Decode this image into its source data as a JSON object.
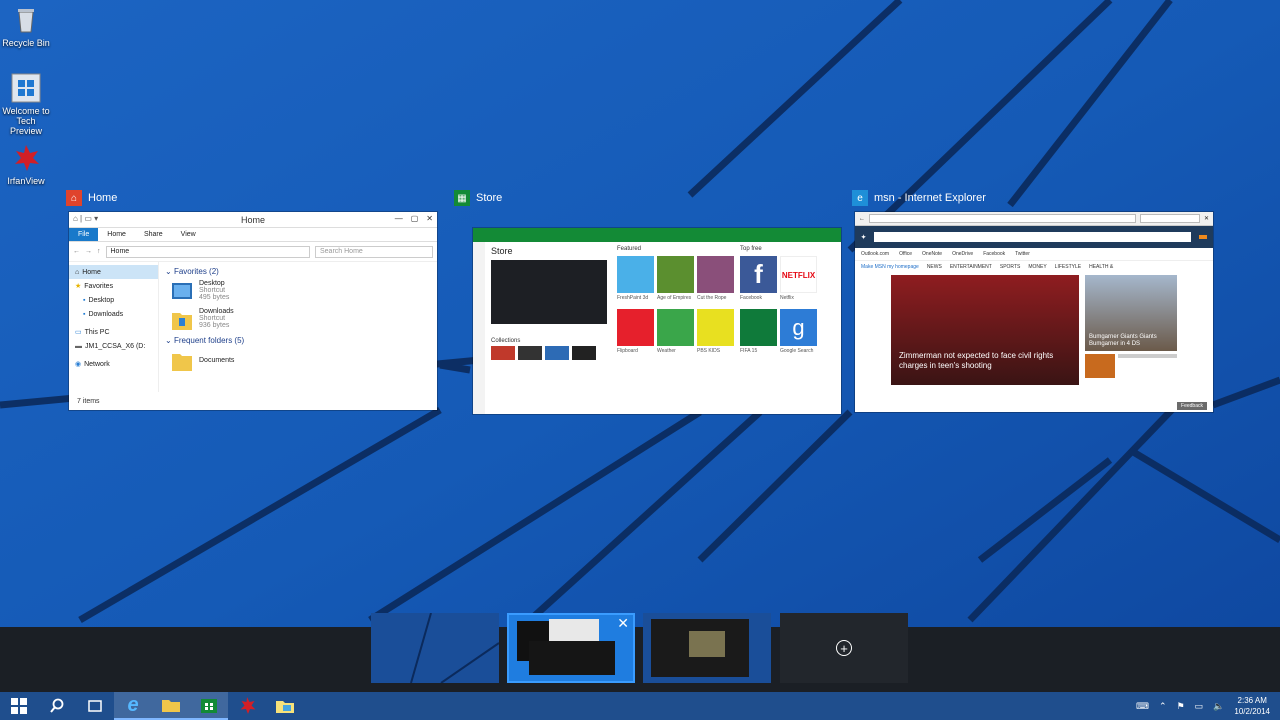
{
  "desktop_icons": [
    {
      "label": "Recycle Bin",
      "icon": "recycle-bin-icon"
    },
    {
      "label": "Welcome to Tech Preview",
      "icon": "windows-logo-icon"
    },
    {
      "label": "IrfanView",
      "icon": "irfanview-icon"
    }
  ],
  "windows": {
    "explorer": {
      "caption": "Home",
      "title": "Home",
      "ribbon_tabs": [
        "File",
        "Home",
        "Share",
        "View"
      ],
      "address": "Home",
      "search_placeholder": "Search Home",
      "nav_items": [
        "Home",
        "Favorites",
        "Desktop",
        "Downloads",
        "This PC",
        "JM1_CCSA_X6 (D:",
        "Network"
      ],
      "favorites_header": "Favorites (2)",
      "favorites": [
        {
          "name": "Desktop",
          "type": "Shortcut",
          "size": "495 bytes"
        },
        {
          "name": "Downloads",
          "type": "Shortcut",
          "size": "936 bytes"
        }
      ],
      "frequent_header": "Frequent folders (5)",
      "frequent": [
        {
          "name": "Documents"
        }
      ],
      "status": "7 items"
    },
    "store": {
      "caption": "Store",
      "heading": "Store",
      "sections": {
        "featured": "Featured",
        "top_free": "Top free",
        "collections": "Collections"
      },
      "featured_apps": [
        "FreshPaint 3d",
        "Age of Empires",
        "Cut the Rope",
        "Flipboard",
        "Weather",
        "PBS KIDS"
      ],
      "top_free_apps": [
        "Facebook",
        "Netflix",
        "FIFA 15",
        "Google Search"
      ]
    },
    "msn": {
      "caption": "msn - Internet Explorer",
      "nav_links": [
        "Outlook.com",
        "Office",
        "OneNote",
        "OneDrive",
        "Facebook",
        "Twitter"
      ],
      "categories": [
        "NEWS",
        "ENTERTAINMENT",
        "SPORTS",
        "MONEY",
        "LIFESTYLE",
        "HEALTH &"
      ],
      "make_homepage": "Make MSN my homepage",
      "hero_headline": "Zimmerman not expected to face civil rights charges in teen's shooting",
      "side_story": "Bumgarner Giants Giants Bumgarner in 4 DS",
      "feedback": "Feedback"
    }
  },
  "virtual_desktops": {
    "count": 4,
    "close_glyph": "✕",
    "add_glyph": "+"
  },
  "taskbar": {
    "buttons": [
      "start-icon",
      "search-icon",
      "task-view-icon",
      "internet-explorer-icon",
      "file-explorer-icon",
      "store-icon",
      "irfanview-icon",
      "welcome-icon"
    ],
    "clock_time": "2:36 AM",
    "clock_date": "10/2/2014"
  }
}
